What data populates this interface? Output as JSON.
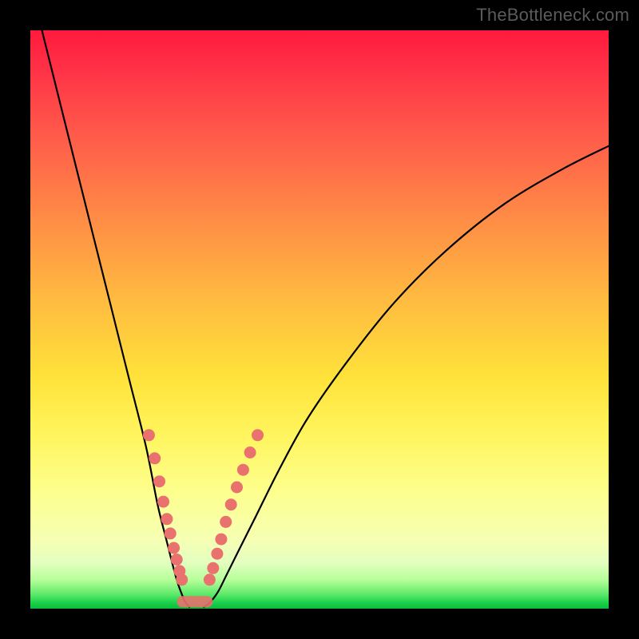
{
  "watermark": "TheBottleneck.com",
  "colors": {
    "bead": "#e9716e",
    "curve": "#000000",
    "frame": "#000000",
    "gradient_top": "#ff1a3d",
    "gradient_bottom": "#0fb93c"
  },
  "chart_data": {
    "type": "line",
    "title": "",
    "xlabel": "",
    "ylabel": "",
    "xlim": [
      0,
      100
    ],
    "ylim": [
      0,
      100
    ],
    "grid": false,
    "legend": false,
    "series": [
      {
        "name": "left-curve",
        "x": [
          2,
          5,
          8,
          11,
          14,
          17,
          20,
          22,
          23.5,
          24.5,
          25.3,
          26,
          26.6,
          27.1,
          27.5
        ],
        "y": [
          100,
          88,
          76,
          64,
          52,
          40,
          28,
          18,
          12,
          8,
          5,
          3,
          1.5,
          0.7,
          0.3
        ]
      },
      {
        "name": "right-curve",
        "x": [
          30,
          31,
          32.5,
          34,
          36,
          39,
          43,
          48,
          55,
          63,
          72,
          82,
          92,
          100
        ],
        "y": [
          0.3,
          1,
          3,
          6,
          10,
          16,
          24,
          33,
          43,
          53,
          62,
          70,
          76,
          80
        ]
      }
    ],
    "beads_left": [
      {
        "x": 20.5,
        "y": 30
      },
      {
        "x": 21.5,
        "y": 26
      },
      {
        "x": 22.3,
        "y": 22
      },
      {
        "x": 23.0,
        "y": 18.5
      },
      {
        "x": 23.6,
        "y": 15.5
      },
      {
        "x": 24.2,
        "y": 13
      },
      {
        "x": 24.8,
        "y": 10.5
      },
      {
        "x": 25.3,
        "y": 8.5
      },
      {
        "x": 25.8,
        "y": 6.5
      },
      {
        "x": 26.2,
        "y": 5
      }
    ],
    "beads_right": [
      {
        "x": 31.0,
        "y": 5
      },
      {
        "x": 31.6,
        "y": 7
      },
      {
        "x": 32.3,
        "y": 9.5
      },
      {
        "x": 33.0,
        "y": 12
      },
      {
        "x": 33.8,
        "y": 15
      },
      {
        "x": 34.7,
        "y": 18
      },
      {
        "x": 35.7,
        "y": 21
      },
      {
        "x": 36.8,
        "y": 24
      },
      {
        "x": 38.0,
        "y": 27
      },
      {
        "x": 39.3,
        "y": 30
      }
    ],
    "bottom_track": {
      "x0": 26.3,
      "x1": 30.6,
      "y": 1.2
    }
  }
}
